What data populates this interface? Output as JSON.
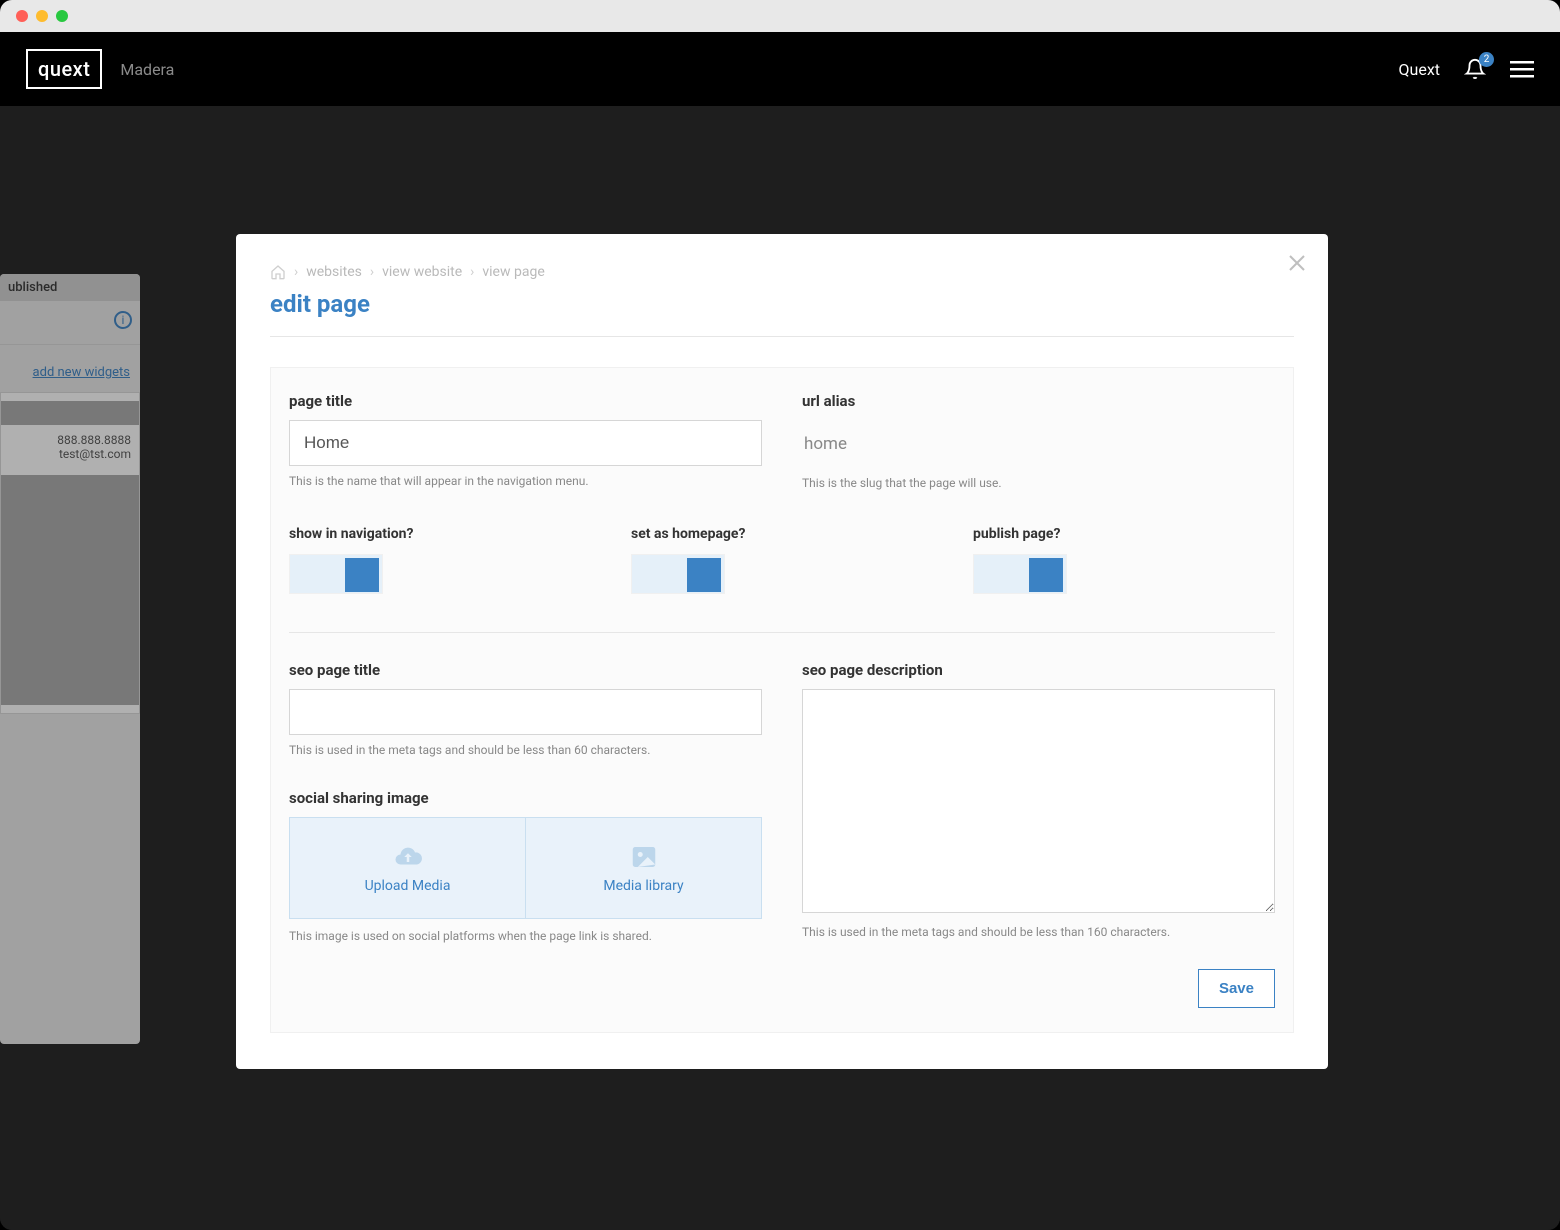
{
  "topbar": {
    "logo_text": "quext",
    "tenant": "Madera",
    "user_label": "Quext",
    "notif_count": "2"
  },
  "bg": {
    "status": "ublished",
    "add_widgets": "add new widgets",
    "phone": "888.888.8888",
    "email": "test@tst.com"
  },
  "modal": {
    "breadcrumb": [
      "websites",
      "view website",
      "view page"
    ],
    "title": "edit page",
    "page_title_label": "page title",
    "page_title_value": "Home",
    "page_title_help": "This is the name that will appear in the navigation menu.",
    "url_alias_label": "url alias",
    "url_alias_value": "home",
    "url_alias_help": "This is the slug that the page will use.",
    "show_nav_label": "show in navigation?",
    "set_home_label": "set as homepage?",
    "publish_label": "publish page?",
    "seo_title_label": "seo page title",
    "seo_title_help": "This is used in the meta tags and should be less than 60 characters.",
    "seo_desc_label": "seo page description",
    "seo_desc_help": "This is used in the meta tags and should be less than 160 characters.",
    "social_label": "social sharing image",
    "social_help": "This image is used on social platforms when the page link is shared.",
    "upload_label": "Upload Media",
    "library_label": "Media library",
    "save_label": "Save"
  }
}
